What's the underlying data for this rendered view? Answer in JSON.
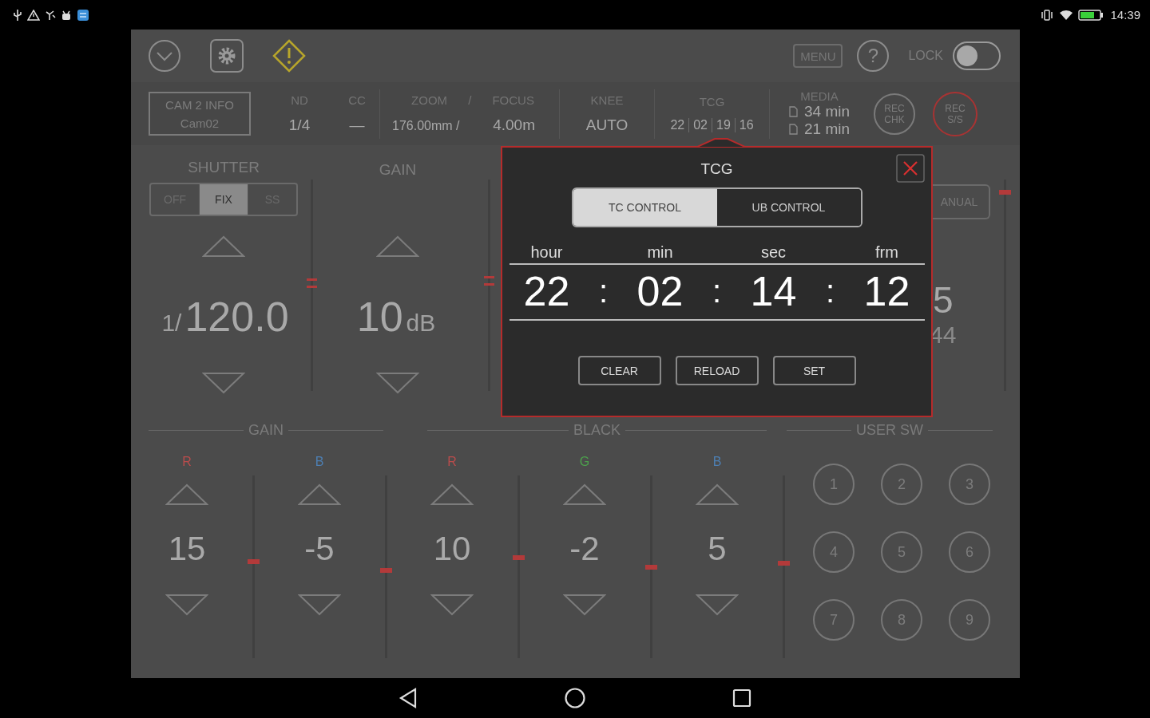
{
  "status_bar": {
    "time": "14:39"
  },
  "toolbar": {
    "menu_button": "MENU",
    "help_button": "?",
    "lock": {
      "label": "LOCK",
      "on": false
    }
  },
  "info": {
    "cam_title": "CAM 2 INFO",
    "cam_name": "Cam02",
    "nd": {
      "label": "ND",
      "value": "1/4"
    },
    "cc": {
      "label": "CC",
      "value": "—"
    },
    "zoom_focus": {
      "zoom_label": "ZOOM",
      "slash_label": "/",
      "focus_label": "FOCUS",
      "zoom_value": "176.00mm /",
      "focus_value": "4.00m"
    },
    "knee": {
      "label": "KNEE",
      "value": "AUTO"
    },
    "tcg": {
      "label": "TCG",
      "values": [
        "22",
        "02",
        "19",
        "16"
      ]
    },
    "media": {
      "label": "MEDIA",
      "slots": [
        {
          "remaining": "34 min"
        },
        {
          "remaining": "21 min"
        }
      ]
    },
    "rec_check": [
      "REC",
      "CHK"
    ],
    "rec_start_stop": [
      "REC",
      "S/S"
    ]
  },
  "shutter": {
    "label": "SHUTTER",
    "modes": [
      {
        "label": "OFF",
        "selected": false
      },
      {
        "label": "FIX",
        "selected": true
      },
      {
        "label": "SS",
        "selected": false
      }
    ],
    "prefix": "1/",
    "value": "120.0",
    "level": 0.51
  },
  "gain": {
    "label": "GAIN",
    "value": "10",
    "unit": "dB",
    "level": 0.52
  },
  "right_partial": {
    "button": "ANUAL",
    "value": "5",
    "sub_value": "44",
    "level": 0.94
  },
  "gain_section": {
    "title": "GAIN",
    "channels": [
      {
        "label": "R",
        "color": "#b94c4c",
        "value": "15",
        "level": 0.53
      },
      {
        "label": "B",
        "color": "#4d7fb3",
        "value": "-5",
        "level": 0.48
      }
    ]
  },
  "black_section": {
    "title": "BLACK",
    "channels": [
      {
        "label": "R",
        "color": "#b94c4c",
        "value": "10",
        "level": 0.55
      },
      {
        "label": "G",
        "color": "#4ca04c",
        "value": "-2",
        "level": 0.5
      },
      {
        "label": "B",
        "color": "#4d7fb3",
        "value": "5",
        "level": 0.52
      }
    ]
  },
  "user_sw": {
    "title": "USER SW",
    "buttons": [
      "1",
      "2",
      "3",
      "4",
      "5",
      "6",
      "7",
      "8",
      "9"
    ]
  },
  "dialog": {
    "title": "TCG",
    "tabs": [
      {
        "label": "TC CONTROL",
        "selected": true
      },
      {
        "label": "UB CONTROL",
        "selected": false
      }
    ],
    "fields": [
      {
        "label": "hour",
        "value": "22"
      },
      {
        "label": "min",
        "value": "02"
      },
      {
        "label": "sec",
        "value": "14"
      },
      {
        "label": "frm",
        "value": "12"
      }
    ],
    "separators": [
      ":",
      ":",
      ":"
    ],
    "buttons": [
      "CLEAR",
      "RELOAD",
      "SET"
    ]
  }
}
